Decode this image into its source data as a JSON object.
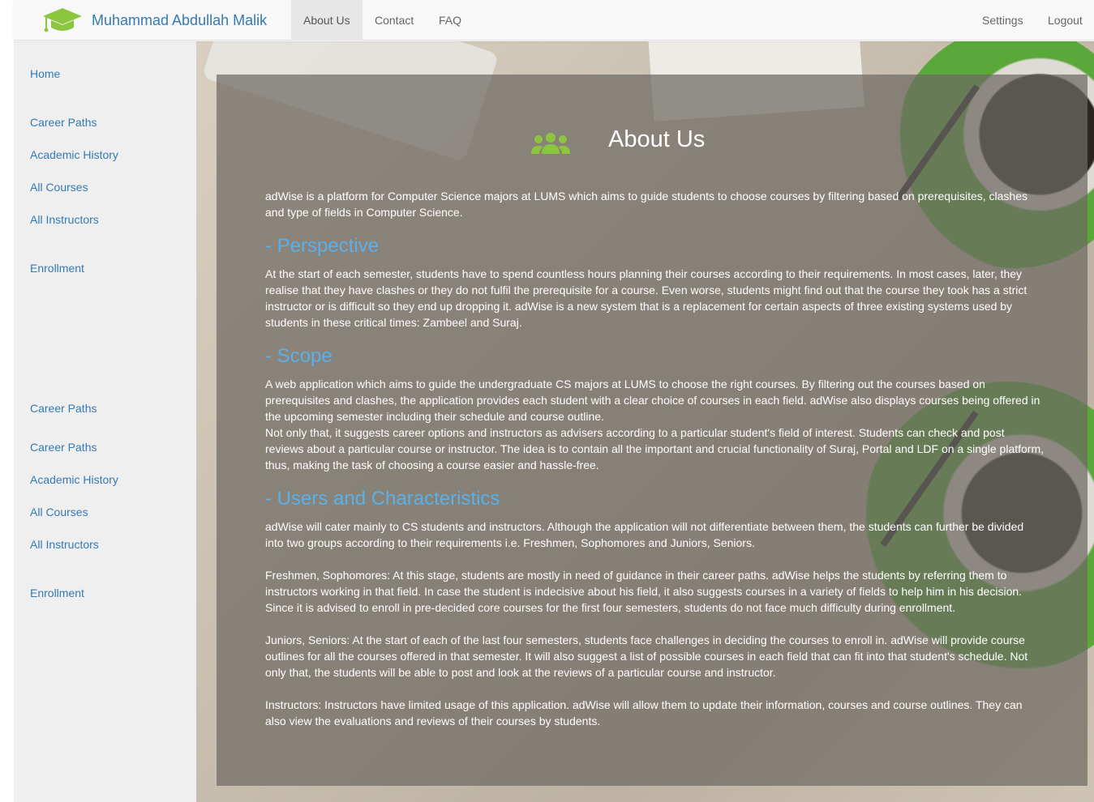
{
  "navbar": {
    "brand": "Muhammad Abdullah Malik",
    "items": [
      "About Us",
      "Contact",
      "FAQ"
    ],
    "active": "About Us",
    "right_items": [
      "Settings",
      "Logout"
    ]
  },
  "sidebar": {
    "group1": [
      "Home",
      "Career Paths",
      "Academic History",
      "All Courses",
      "All Instructors",
      "Enrollment"
    ],
    "group2": [
      "Career Paths",
      "Career Paths",
      "Academic History",
      "All Courses",
      "All Instructors",
      "Enrollment"
    ]
  },
  "main": {
    "title": "About Us",
    "intro": "adWise is a platform for Computer Science majors at LUMS which aims to guide students to choose courses by filtering based on prerequisites, clashes and type of fields in Computer Science.",
    "perspective_heading": "- Perspective",
    "perspective": "At the start of each semester, students have to spend countless hours planning their courses according to their requirements. In most cases, later, they realise that they have clashes or they do not fulfil the prerequisite for a course. Even worse, students might find out that the course they took has a strict instructor or is difficult so they end up dropping it. adWise is a new system that is a replacement for certain aspects of three existing systems used by students in these critical times: Zambeel and Suraj.",
    "scope_heading": "- Scope",
    "scope_p1": "A web application which aims to guide the undergraduate CS majors at LUMS to choose the right courses. By filtering out the courses based on prerequisites and clashes, the application provides each student with a clear choice of courses in each field. adWise also displays courses being offered in the upcoming semester including their schedule and course outline.",
    "scope_p2": "Not only that, it suggests career options and instructors as advisers according to a particular student's field of interest. Students can check and post reviews about a particular course or instructor. The idea is to contain all the important and crucial functionality of Suraj, Portal and LDF on a single platform, thus, making the task of choosing a course easier and hassle-free.",
    "users_heading": "- Users and Characteristics",
    "users_p1": "adWise will cater mainly to CS students and instructors. Although the application will not differentiate between them, the students can further be divided into two groups according to their requirements i.e. Freshmen, Sophomores and Juniors, Seniors.",
    "users_p2": "Freshmen, Sophomores: At this stage, students are mostly in need of guidance in their career paths. adWise helps the students by referring them to instructors working in that field. In case the student is indecisive about his field, it also suggests courses in a variety of fields to help him in his decision. Since it is advised to enroll in pre-decided core courses for the first four semesters, students do not face much difficulty during enrollment.",
    "users_p3": "Juniors, Seniors: At the start of each of the last four semesters, students face challenges in deciding the courses to enroll in. adWise will provide course outlines for all the courses offered in that semester. It will also suggest a list of possible courses in each field that can fit into that student's schedule. Not only that, the students will be able to post and look at the reviews of a particular course and instructor.",
    "users_p4": "Instructors: Instructors have limited usage of this application. adWise will allow them to update their information, courses and course outlines. They can also view the evaluations and reviews of their courses by students."
  },
  "colors": {
    "accent": "#337ab7",
    "heading": "#5bb0e8",
    "icon_green": "#8cc63f"
  },
  "icons": [
    "graduation-cap-icon",
    "people-icon"
  ]
}
